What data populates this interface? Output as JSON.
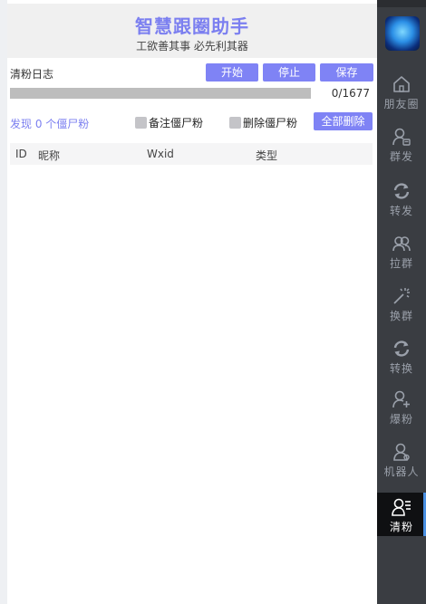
{
  "header": {
    "title": "智慧跟圈助手",
    "subtitle": "工欲善其事 必先利其器"
  },
  "toolbar": {
    "log_label": "清粉日志",
    "start_label": "开始",
    "stop_label": "停止",
    "save_label": "保存"
  },
  "progress": {
    "current": 0,
    "total": 1677,
    "text": "0/1677"
  },
  "filter": {
    "found_text": "发现 0 个僵尸粉",
    "note_checkbox": "备注僵尸粉",
    "delete_checkbox": "删除僵尸粉",
    "delete_all_label": "全部删除"
  },
  "table": {
    "columns": [
      "ID",
      "昵称",
      "Wxid",
      "类型"
    ]
  },
  "sidebar": {
    "items": [
      {
        "label": "朋友圈",
        "icon": "home-icon"
      },
      {
        "label": "群发",
        "icon": "user-message-icon"
      },
      {
        "label": "转发",
        "icon": "refresh-icon"
      },
      {
        "label": "拉群",
        "icon": "group-icon"
      },
      {
        "label": "换群",
        "icon": "sparkle-icon"
      },
      {
        "label": "转换",
        "icon": "refresh-icon"
      },
      {
        "label": "爆粉",
        "icon": "add-user-icon"
      },
      {
        "label": "机器人",
        "icon": "robot-user-icon"
      },
      {
        "label": "清粉",
        "icon": "user-list-icon"
      }
    ],
    "active_index": 8
  },
  "colors": {
    "accent": "#7f83f5",
    "sidebar_bg": "#3a3d42",
    "active_bg": "#0f1012"
  }
}
